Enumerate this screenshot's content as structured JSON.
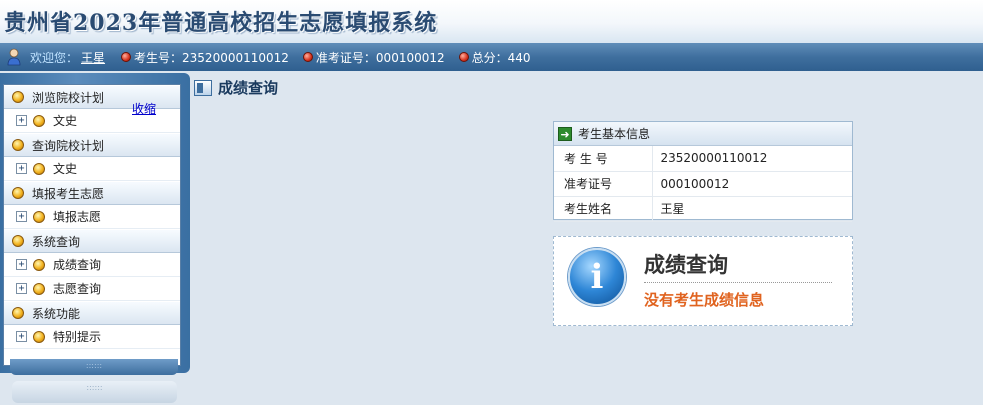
{
  "header": {
    "title": "贵州省2023年普通高校招生志愿填报系统"
  },
  "infobar": {
    "welcome_label": "欢迎您：",
    "user_name": "王星",
    "exam_no": "考生号：23520000110012",
    "ticket_no": "准考证号：000100012",
    "total_score": "总分：440"
  },
  "sidebar": {
    "collapse_label": "收缩",
    "groups": [
      {
        "label": "浏览院校计划",
        "items": [
          "文史"
        ]
      },
      {
        "label": "查询院校计划",
        "items": [
          "文史"
        ]
      },
      {
        "label": "填报考生志愿",
        "items": [
          "填报志愿"
        ]
      },
      {
        "label": "系统查询",
        "items": [
          "成绩查询",
          "志愿查询"
        ]
      },
      {
        "label": "系统功能",
        "items": [
          "特别提示"
        ]
      }
    ],
    "grip_text": "::::::"
  },
  "main": {
    "page_title": "成绩查询",
    "info_box": {
      "title": "考生基本信息",
      "rows": [
        {
          "key": "考 生 号",
          "value": "23520000110012"
        },
        {
          "key": "准考证号",
          "value": "000100012"
        },
        {
          "key": "考生姓名",
          "value": "王星"
        }
      ]
    },
    "message": {
      "title": "成绩查询",
      "text": "没有考生成绩信息",
      "icon_glyph": "i"
    }
  },
  "colors": {
    "accent": "#3f6f9e",
    "warning_text": "#e0631f",
    "heading": "#1a3a5e"
  }
}
